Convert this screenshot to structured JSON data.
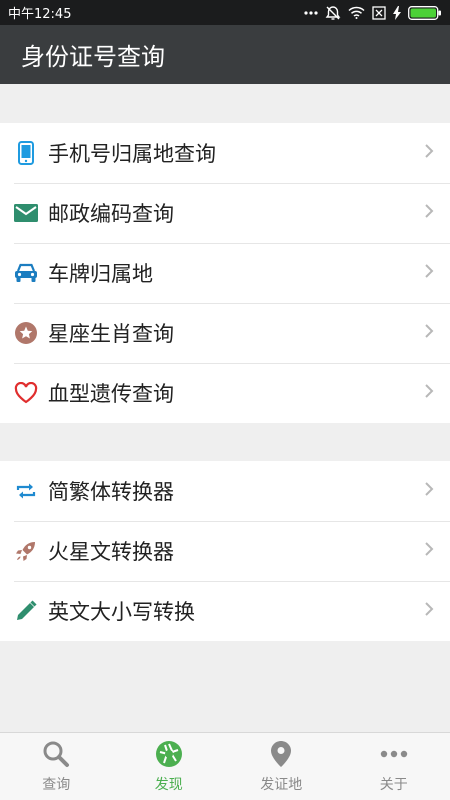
{
  "status_bar": {
    "time": "中午12:45",
    "icons": [
      "more-dots-icon",
      "alarm-off-icon",
      "wifi-icon",
      "sim-off-icon",
      "charging-icon",
      "battery-icon"
    ]
  },
  "app_bar": {
    "title": "身份证号查询"
  },
  "groups": [
    {
      "items": [
        {
          "label": "手机号归属地查询",
          "icon": "phone-icon",
          "color": "#1f9be0"
        },
        {
          "label": "邮政编码查询",
          "icon": "mail-icon",
          "color": "#2f8e6e"
        },
        {
          "label": "车牌归属地",
          "icon": "car-icon",
          "color": "#1b7dc0"
        },
        {
          "label": "星座生肖查询",
          "icon": "star-icon",
          "color": "#b0776a"
        },
        {
          "label": "血型遗传查询",
          "icon": "heart-icon",
          "color": "#e02e2e"
        }
      ]
    },
    {
      "items": [
        {
          "label": "简繁体转换器",
          "icon": "swap-icon",
          "color": "#1f8ad0"
        },
        {
          "label": "火星文转换器",
          "icon": "rocket-icon",
          "color": "#b0776a"
        },
        {
          "label": "英文大小写转换",
          "icon": "pencil-icon",
          "color": "#2f8e6e"
        }
      ]
    }
  ],
  "tab_bar": {
    "tabs": [
      {
        "label": "查询",
        "icon": "search-icon"
      },
      {
        "label": "发现",
        "icon": "aperture-icon",
        "active": true
      },
      {
        "label": "发证地",
        "icon": "location-pin-icon"
      },
      {
        "label": "关于",
        "icon": "more-icon"
      }
    ],
    "active_color": "#4caf50"
  }
}
